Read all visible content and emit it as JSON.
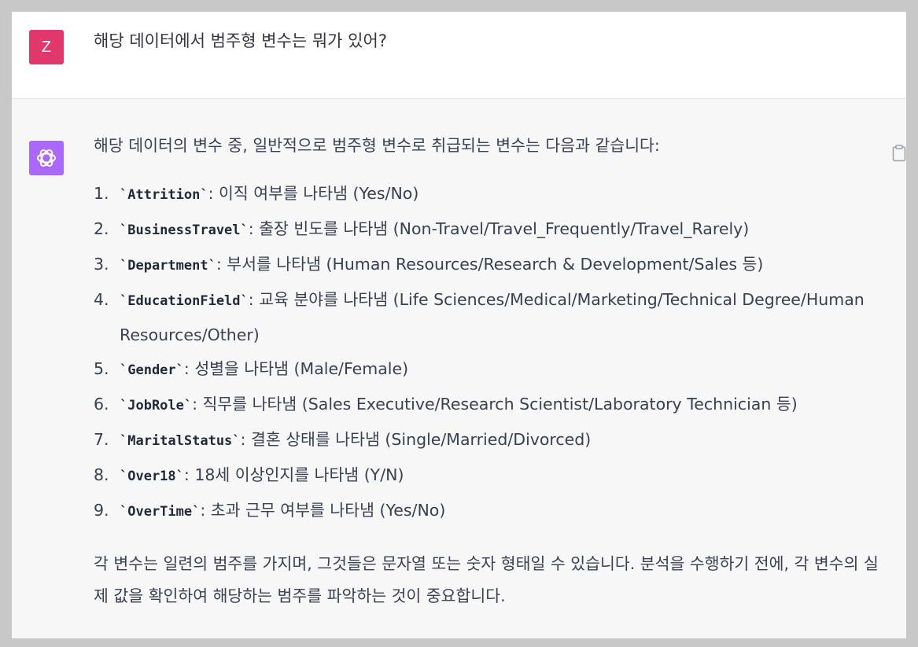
{
  "user": {
    "avatar_letter": "Z",
    "message": "해당 데이터에서 범주형 변수는 뭐가 있어?"
  },
  "assistant": {
    "avatar_icon": "openai-logo-icon",
    "intro": "해당 데이터의 변수 중, 일반적으로 범주형 변수로 취급되는 변수는 다음과 같습니다:",
    "items": [
      {
        "num": "1.",
        "code": "`Attrition`",
        "desc": ": 이직 여부를 나타냄 (Yes/No)"
      },
      {
        "num": "2.",
        "code": "`BusinessTravel`",
        "desc": ": 출장 빈도를 나타냄 (Non-Travel/Travel_Frequently/Travel_Rarely)"
      },
      {
        "num": "3.",
        "code": "`Department`",
        "desc": ": 부서를 나타냄 (Human Resources/Research & Development/Sales 등)"
      },
      {
        "num": "4.",
        "code": "`EducationField`",
        "desc": ": 교육 분야를 나타냄 (Life Sciences/Medical/Marketing/Technical Degree/Human Resources/Other)"
      },
      {
        "num": "5.",
        "code": "`Gender`",
        "desc": ": 성별을 나타냄 (Male/Female)"
      },
      {
        "num": "6.",
        "code": "`JobRole`",
        "desc": ": 직무를 나타냄 (Sales Executive/Research Scientist/Laboratory Technician 등)"
      },
      {
        "num": "7.",
        "code": "`MaritalStatus`",
        "desc": ": 결혼 상태를 나타냄 (Single/Married/Divorced)"
      },
      {
        "num": "8.",
        "code": "`Over18`",
        "desc": ": 18세 이상인지를 나타냄 (Y/N)"
      },
      {
        "num": "9.",
        "code": "`OverTime`",
        "desc": ": 초과 근무 여부를 나타냄 (Yes/No)"
      }
    ],
    "outro": "각 변수는 일련의 범주를 가지며, 그것들은 문자열 또는 숫자 형태일 수 있습니다. 분석을 수행하기 전에, 각 변수의 실제 값을 확인하여 해당하는 범주를 파악하는 것이 중요합니다.",
    "copy_icon": "clipboard-icon"
  },
  "colors": {
    "user_avatar": "#e0386d",
    "assistant_avatar": "#ab68ff",
    "assistant_bg": "#f7f7f8"
  }
}
